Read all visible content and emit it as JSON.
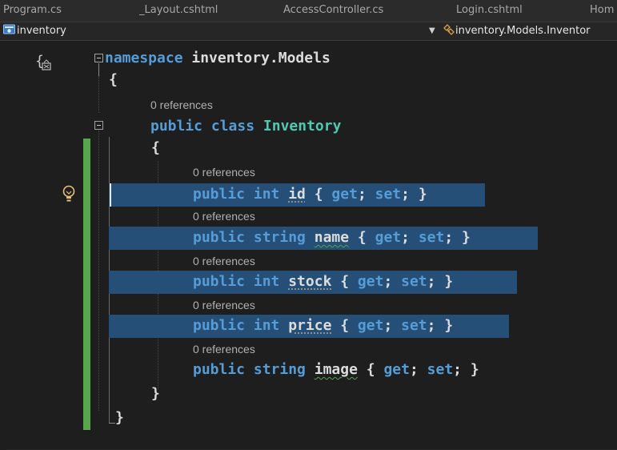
{
  "tabs": [
    "Program.cs",
    "_Layout.cshtml",
    "AccessController.cs",
    "Login.cshtml",
    "Hom"
  ],
  "nav": {
    "project": "inventory",
    "member": "inventory.Models.Inventor"
  },
  "code": {
    "margin_brace": "{",
    "l1_kw": "namespace",
    "l1_name": " inventory.Models",
    "l2": "{",
    "refs": "0 references",
    "l3_kw": "public class ",
    "l3_type": "Inventory",
    "l4": "{",
    "props": [
      {
        "type": "int",
        "name": "id"
      },
      {
        "type": "string",
        "name": "name"
      },
      {
        "type": "int",
        "name": "stock"
      },
      {
        "type": "int",
        "name": "price"
      },
      {
        "type": "string",
        "name": "image"
      }
    ],
    "kw_public": "public ",
    "kw_get": "get",
    "kw_set": "set",
    "brace_open": " { ",
    "semi_space": "; ",
    "semi_close": "; }",
    "close_class": "}",
    "close_ns": "}"
  },
  "colors": {
    "keyword": "#569cd6",
    "type": "#4ec9b0",
    "selection": "#264f78",
    "change_bar": "#57a64a"
  },
  "icons": [
    "project-icon",
    "class-icon",
    "lightbulb-icon"
  ]
}
